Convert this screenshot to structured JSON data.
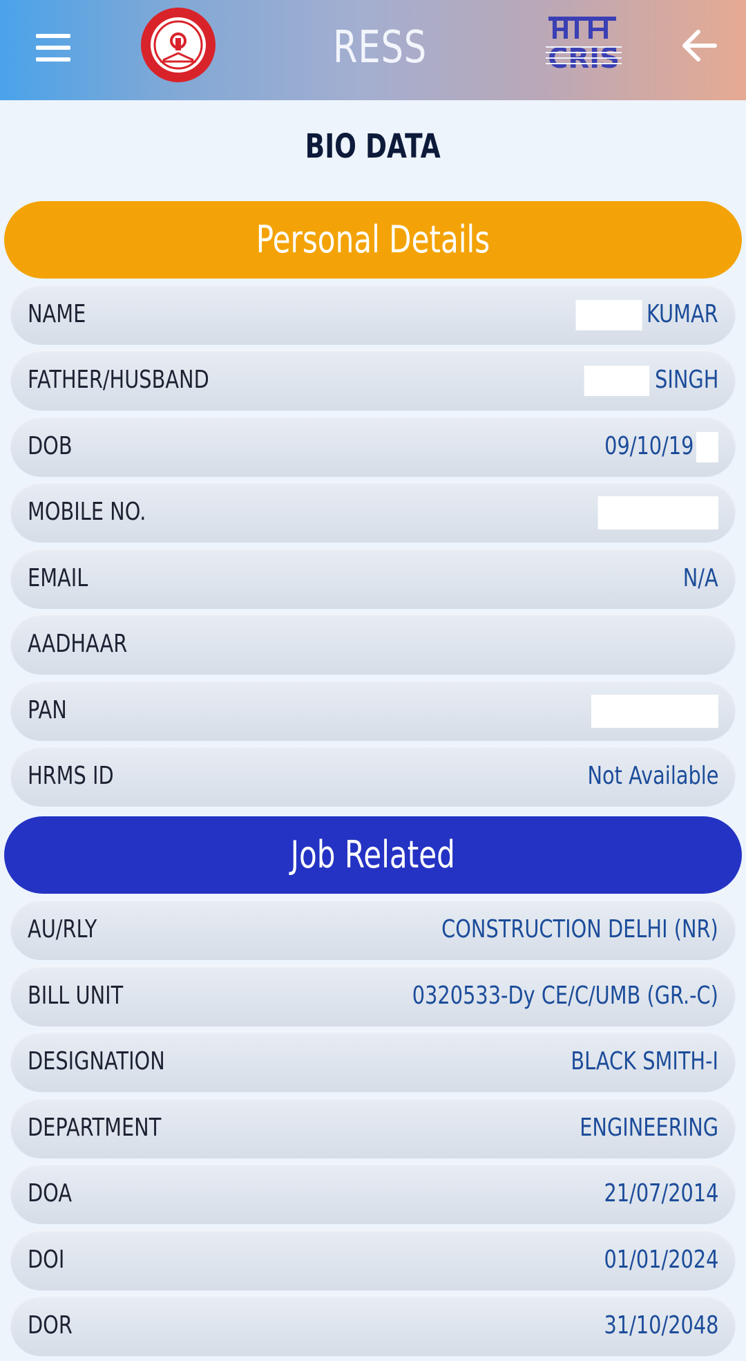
{
  "header": {
    "app_title": "RESS",
    "menu_icon": "hamburger-menu-icon",
    "left_logo": "indian-railways-emblem-icon",
    "right_logo": "cris-logo-icon",
    "back_icon": "arrow-left-icon"
  },
  "page": {
    "title": "BIO DATA"
  },
  "personal": {
    "heading": "Personal Details",
    "rows": [
      {
        "label": "NAME",
        "value": "KUMAR"
      },
      {
        "label": "FATHER/HUSBAND",
        "value": "SINGH"
      },
      {
        "label": "DOB",
        "value": "09/10/19"
      },
      {
        "label": "MOBILE NO.",
        "value": ""
      },
      {
        "label": "EMAIL",
        "value": "N/A"
      },
      {
        "label": "AADHAAR",
        "value": ""
      },
      {
        "label": "PAN",
        "value": ""
      },
      {
        "label": "HRMS ID",
        "value": "Not Available"
      }
    ]
  },
  "job": {
    "heading": "Job Related",
    "rows": [
      {
        "label": "AU/RLY",
        "value": "CONSTRUCTION DELHI (NR)"
      },
      {
        "label": "BILL UNIT",
        "value": "0320533-Dy CE/C/UMB (GR.-C)"
      },
      {
        "label": "DESIGNATION",
        "value": "BLACK SMITH-I"
      },
      {
        "label": "DEPARTMENT",
        "value": "ENGINEERING"
      },
      {
        "label": "DOA",
        "value": "21/07/2014"
      },
      {
        "label": "DOI",
        "value": "01/01/2024"
      },
      {
        "label": "DOR",
        "value": "31/10/2048"
      }
    ]
  },
  "colors": {
    "personal_banner": "#f3a307",
    "job_banner": "#2433c3",
    "value_text": "#1c4c9a",
    "label_text": "#1d2233"
  }
}
